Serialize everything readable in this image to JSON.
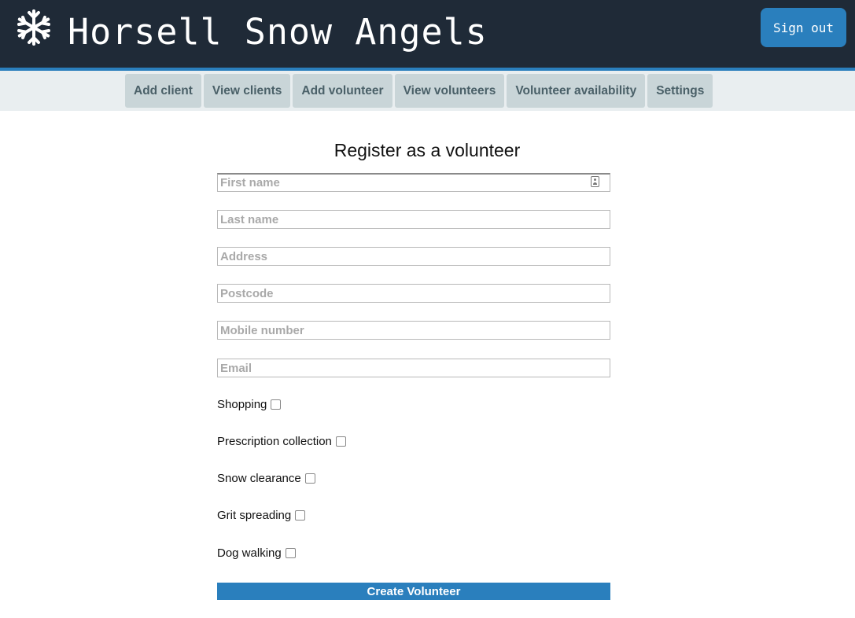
{
  "app": {
    "title": "Horsell Snow Angels",
    "logo_icon": "snowflake-icon",
    "sign_out_label": "Sign out"
  },
  "nav": {
    "items": [
      {
        "label": "Add client"
      },
      {
        "label": "View clients"
      },
      {
        "label": "Add volunteer"
      },
      {
        "label": "View volunteers"
      },
      {
        "label": "Volunteer availability"
      },
      {
        "label": "Settings"
      }
    ]
  },
  "form": {
    "title": "Register as a volunteer",
    "fields": [
      {
        "placeholder": "First name",
        "value": ""
      },
      {
        "placeholder": "Last name",
        "value": ""
      },
      {
        "placeholder": "Address",
        "value": ""
      },
      {
        "placeholder": "Postcode",
        "value": ""
      },
      {
        "placeholder": "Mobile number",
        "value": ""
      },
      {
        "placeholder": "Email",
        "value": ""
      }
    ],
    "services": [
      {
        "label": "Shopping",
        "checked": false
      },
      {
        "label": "Prescription collection",
        "checked": false
      },
      {
        "label": "Snow clearance",
        "checked": false
      },
      {
        "label": "Grit spreading",
        "checked": false
      },
      {
        "label": "Dog walking",
        "checked": false
      }
    ],
    "submit_label": "Create Volunteer"
  },
  "colors": {
    "header_bg": "#1f2a37",
    "accent": "#2a7fbd",
    "nav_bg": "#e9eef0",
    "nav_item_bg": "#c9d5d8",
    "nav_item_text": "#4a6068"
  }
}
